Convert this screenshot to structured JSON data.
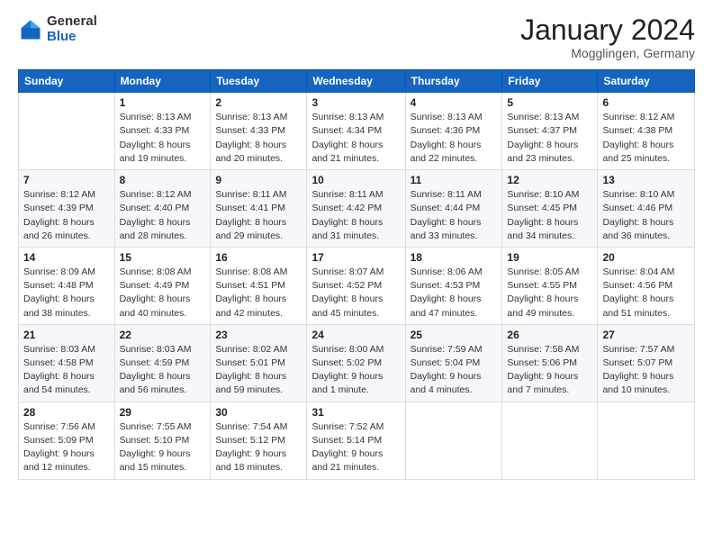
{
  "header": {
    "logo_general": "General",
    "logo_blue": "Blue",
    "month": "January 2024",
    "location": "Mogglingen, Germany"
  },
  "weekdays": [
    "Sunday",
    "Monday",
    "Tuesday",
    "Wednesday",
    "Thursday",
    "Friday",
    "Saturday"
  ],
  "weeks": [
    [
      {
        "day": "",
        "info": ""
      },
      {
        "day": "1",
        "info": "Sunrise: 8:13 AM\nSunset: 4:33 PM\nDaylight: 8 hours\nand 19 minutes."
      },
      {
        "day": "2",
        "info": "Sunrise: 8:13 AM\nSunset: 4:33 PM\nDaylight: 8 hours\nand 20 minutes."
      },
      {
        "day": "3",
        "info": "Sunrise: 8:13 AM\nSunset: 4:34 PM\nDaylight: 8 hours\nand 21 minutes."
      },
      {
        "day": "4",
        "info": "Sunrise: 8:13 AM\nSunset: 4:36 PM\nDaylight: 8 hours\nand 22 minutes."
      },
      {
        "day": "5",
        "info": "Sunrise: 8:13 AM\nSunset: 4:37 PM\nDaylight: 8 hours\nand 23 minutes."
      },
      {
        "day": "6",
        "info": "Sunrise: 8:12 AM\nSunset: 4:38 PM\nDaylight: 8 hours\nand 25 minutes."
      }
    ],
    [
      {
        "day": "7",
        "info": "Sunrise: 8:12 AM\nSunset: 4:39 PM\nDaylight: 8 hours\nand 26 minutes."
      },
      {
        "day": "8",
        "info": "Sunrise: 8:12 AM\nSunset: 4:40 PM\nDaylight: 8 hours\nand 28 minutes."
      },
      {
        "day": "9",
        "info": "Sunrise: 8:11 AM\nSunset: 4:41 PM\nDaylight: 8 hours\nand 29 minutes."
      },
      {
        "day": "10",
        "info": "Sunrise: 8:11 AM\nSunset: 4:42 PM\nDaylight: 8 hours\nand 31 minutes."
      },
      {
        "day": "11",
        "info": "Sunrise: 8:11 AM\nSunset: 4:44 PM\nDaylight: 8 hours\nand 33 minutes."
      },
      {
        "day": "12",
        "info": "Sunrise: 8:10 AM\nSunset: 4:45 PM\nDaylight: 8 hours\nand 34 minutes."
      },
      {
        "day": "13",
        "info": "Sunrise: 8:10 AM\nSunset: 4:46 PM\nDaylight: 8 hours\nand 36 minutes."
      }
    ],
    [
      {
        "day": "14",
        "info": "Sunrise: 8:09 AM\nSunset: 4:48 PM\nDaylight: 8 hours\nand 38 minutes."
      },
      {
        "day": "15",
        "info": "Sunrise: 8:08 AM\nSunset: 4:49 PM\nDaylight: 8 hours\nand 40 minutes."
      },
      {
        "day": "16",
        "info": "Sunrise: 8:08 AM\nSunset: 4:51 PM\nDaylight: 8 hours\nand 42 minutes."
      },
      {
        "day": "17",
        "info": "Sunrise: 8:07 AM\nSunset: 4:52 PM\nDaylight: 8 hours\nand 45 minutes."
      },
      {
        "day": "18",
        "info": "Sunrise: 8:06 AM\nSunset: 4:53 PM\nDaylight: 8 hours\nand 47 minutes."
      },
      {
        "day": "19",
        "info": "Sunrise: 8:05 AM\nSunset: 4:55 PM\nDaylight: 8 hours\nand 49 minutes."
      },
      {
        "day": "20",
        "info": "Sunrise: 8:04 AM\nSunset: 4:56 PM\nDaylight: 8 hours\nand 51 minutes."
      }
    ],
    [
      {
        "day": "21",
        "info": "Sunrise: 8:03 AM\nSunset: 4:58 PM\nDaylight: 8 hours\nand 54 minutes."
      },
      {
        "day": "22",
        "info": "Sunrise: 8:03 AM\nSunset: 4:59 PM\nDaylight: 8 hours\nand 56 minutes."
      },
      {
        "day": "23",
        "info": "Sunrise: 8:02 AM\nSunset: 5:01 PM\nDaylight: 8 hours\nand 59 minutes."
      },
      {
        "day": "24",
        "info": "Sunrise: 8:00 AM\nSunset: 5:02 PM\nDaylight: 9 hours\nand 1 minute."
      },
      {
        "day": "25",
        "info": "Sunrise: 7:59 AM\nSunset: 5:04 PM\nDaylight: 9 hours\nand 4 minutes."
      },
      {
        "day": "26",
        "info": "Sunrise: 7:58 AM\nSunset: 5:06 PM\nDaylight: 9 hours\nand 7 minutes."
      },
      {
        "day": "27",
        "info": "Sunrise: 7:57 AM\nSunset: 5:07 PM\nDaylight: 9 hours\nand 10 minutes."
      }
    ],
    [
      {
        "day": "28",
        "info": "Sunrise: 7:56 AM\nSunset: 5:09 PM\nDaylight: 9 hours\nand 12 minutes."
      },
      {
        "day": "29",
        "info": "Sunrise: 7:55 AM\nSunset: 5:10 PM\nDaylight: 9 hours\nand 15 minutes."
      },
      {
        "day": "30",
        "info": "Sunrise: 7:54 AM\nSunset: 5:12 PM\nDaylight: 9 hours\nand 18 minutes."
      },
      {
        "day": "31",
        "info": "Sunrise: 7:52 AM\nSunset: 5:14 PM\nDaylight: 9 hours\nand 21 minutes."
      },
      {
        "day": "",
        "info": ""
      },
      {
        "day": "",
        "info": ""
      },
      {
        "day": "",
        "info": ""
      }
    ]
  ]
}
